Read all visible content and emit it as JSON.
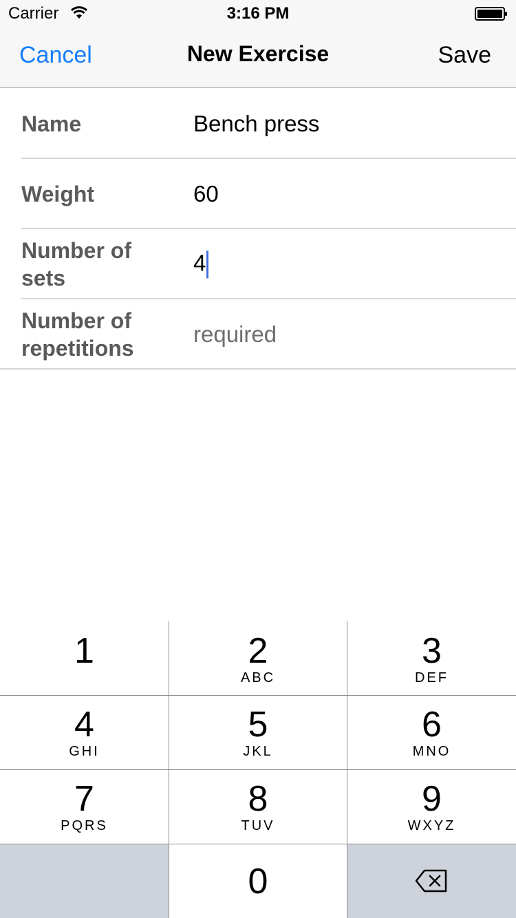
{
  "status_bar": {
    "carrier": "Carrier",
    "time": "3:16 PM",
    "icons": [
      "wifi-icon",
      "battery-icon"
    ]
  },
  "nav": {
    "cancel_label": "Cancel",
    "title": "New Exercise",
    "save_label": "Save",
    "accent_color": "#147efb"
  },
  "form": {
    "rows": [
      {
        "label": "Name",
        "value": "Bench press",
        "placeholder": ""
      },
      {
        "label": "Weight",
        "value": "60",
        "placeholder": ""
      },
      {
        "label": "Number of sets",
        "value": "4",
        "placeholder": "",
        "focused": true
      },
      {
        "label": "Number of repetitions",
        "value": "",
        "placeholder": "required"
      }
    ]
  },
  "keypad": {
    "keys": [
      {
        "digit": "1",
        "letters": ""
      },
      {
        "digit": "2",
        "letters": "ABC"
      },
      {
        "digit": "3",
        "letters": "DEF"
      },
      {
        "digit": "4",
        "letters": "GHI"
      },
      {
        "digit": "5",
        "letters": "JKL"
      },
      {
        "digit": "6",
        "letters": "MNO"
      },
      {
        "digit": "7",
        "letters": "PQRS"
      },
      {
        "digit": "8",
        "letters": "TUV"
      },
      {
        "digit": "9",
        "letters": "WXYZ"
      },
      {
        "digit": "0",
        "letters": ""
      }
    ],
    "delete_icon": "delete-backspace-icon"
  }
}
